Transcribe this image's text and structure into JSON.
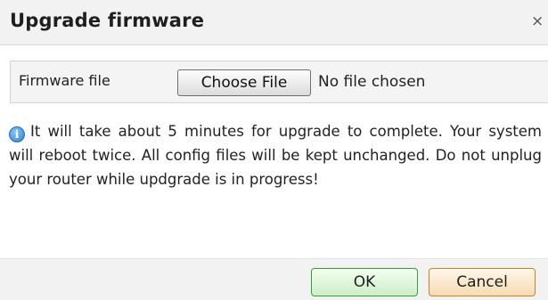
{
  "dialog": {
    "title": "Upgrade firmware",
    "close_glyph": "×"
  },
  "firmware": {
    "label": "Firmware file",
    "choose_button": "Choose File",
    "status": "No file chosen"
  },
  "info": {
    "icon": "info-icon",
    "message": "It will take about 5 minutes for upgrade to complete. Your system will reboot twice. All config files will be kept unchanged. Do not unplug your router while updgrade is in progress!"
  },
  "buttons": {
    "ok": "OK",
    "cancel": "Cancel"
  },
  "colors": {
    "ok_border": "#2fa32f",
    "cancel_border": "#c9841f",
    "info_icon": "#2f7fd0"
  }
}
